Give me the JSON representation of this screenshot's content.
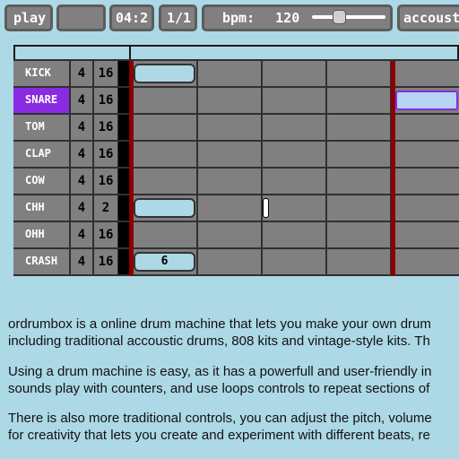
{
  "toolbar": {
    "play_label": "play",
    "blank_label": "",
    "position": "04:2",
    "pattern": "1/1",
    "bpm_label": "bpm:",
    "bpm_value": "120",
    "bpm_slider_fraction": 0.34,
    "kit_label": "accoustic"
  },
  "tracks": [
    {
      "name": "KICK",
      "volume": "4",
      "length": "16",
      "selected": false
    },
    {
      "name": "SNARE",
      "volume": "4",
      "length": "16",
      "selected": true
    },
    {
      "name": "TOM",
      "volume": "4",
      "length": "16",
      "selected": false
    },
    {
      "name": "CLAP",
      "volume": "4",
      "length": "16",
      "selected": false
    },
    {
      "name": "COW",
      "volume": "4",
      "length": "16",
      "selected": false
    },
    {
      "name": "CHH",
      "volume": "4",
      "length": "2",
      "selected": false
    },
    {
      "name": "OHH",
      "volume": "4",
      "length": "16",
      "selected": false
    },
    {
      "name": "CRASH",
      "volume": "4",
      "length": "16",
      "selected": false
    }
  ],
  "notes": [
    {
      "track": "KICK",
      "label": ""
    },
    {
      "track": "SNARE",
      "label": ""
    },
    {
      "track": "CHH",
      "label": ""
    },
    {
      "track": "CRASH",
      "label": "6"
    }
  ],
  "description": {
    "p1_line1": "ordrumbox is a online drum machine that lets you make your own drum",
    "p1_line2": "including traditional accoustic drums, 808 kits and vintage-style kits. Th",
    "p2_line1": "Using a drum machine is easy, as it has a powerfull and user-friendly in",
    "p2_line2": "sounds play with counters, and use loops controls to repeat sections of",
    "p3_line1": "There is also more traditional controls, you can adjust the pitch, volume",
    "p3_line2": "for creativity that lets you create and experiment with different beats, re"
  },
  "colors": {
    "background": "#add8e6",
    "button": "#808080",
    "selected_track": "#8a2be2",
    "loop_marker": "#8b0000"
  }
}
